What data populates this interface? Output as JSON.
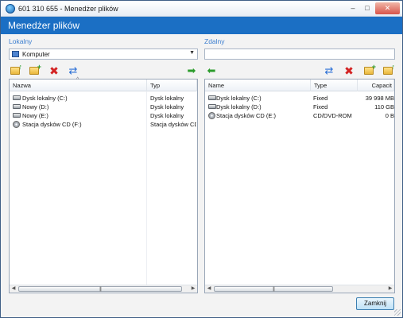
{
  "window": {
    "title": "601 310 655 - Menedżer plików",
    "min_glyph": "–",
    "max_glyph": "□",
    "close_glyph": "✕"
  },
  "header": {
    "title": "Menedżer plików"
  },
  "local": {
    "label": "Lokalny",
    "location": "Komputer",
    "columns": [
      "Nazwa",
      "Typ"
    ],
    "rows": [
      {
        "name": "Dysk lokalny (C:)",
        "type": "Dysk lokalny",
        "icon": "hard-drive-icon"
      },
      {
        "name": "Nowy (D:)",
        "type": "Dysk lokalny",
        "icon": "hard-drive-icon"
      },
      {
        "name": "Nowy (E:)",
        "type": "Dysk lokalny",
        "icon": "hard-drive-icon"
      },
      {
        "name": "Stacja dysków CD (F:)",
        "type": "Stacja dysków CD",
        "icon": "cd-drive-icon"
      }
    ]
  },
  "remote": {
    "label": "Zdalny",
    "path": "",
    "columns": [
      "Name",
      "Type",
      "Capacit"
    ],
    "rows": [
      {
        "name": "Dysk lokalny (C:)",
        "type": "Fixed",
        "capacity": "39 998 MB",
        "icon": "hard-drive-icon"
      },
      {
        "name": "Dysk lokalny (D:)",
        "type": "Fixed",
        "capacity": "110 GB",
        "icon": "hard-drive-icon"
      },
      {
        "name": "Stacja dysków CD (E:)",
        "type": "CD/DVD-ROM",
        "capacity": "0 B",
        "icon": "cd-drive-icon"
      }
    ]
  },
  "buttons": {
    "close": "Zamknij"
  },
  "colors": {
    "header": "#1b6fc4",
    "section_label": "#3d7fd0",
    "delete": "#d32323",
    "transfer": "#2c9c2c"
  }
}
